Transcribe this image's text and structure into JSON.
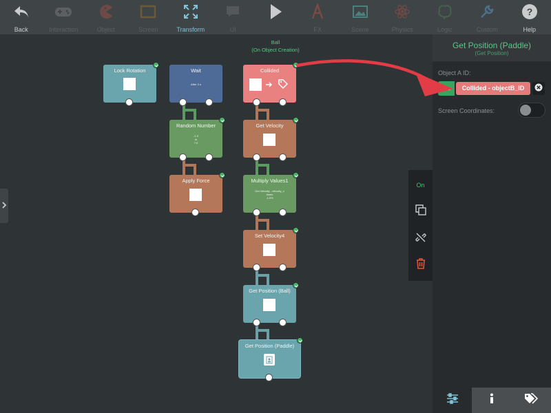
{
  "toolbar": {
    "items": [
      {
        "label": "Back",
        "icon": "back-arrow-icon",
        "state": "on"
      },
      {
        "label": "Interaction",
        "icon": "gamepad-icon",
        "state": "off"
      },
      {
        "label": "Object",
        "icon": "pacman-icon",
        "state": "off"
      },
      {
        "label": "Screen",
        "icon": "screen-frame-icon",
        "state": "off"
      },
      {
        "label": "Transform",
        "icon": "arrows-expand-icon",
        "state": "active"
      },
      {
        "label": "UI",
        "icon": "speech-bubble-icon",
        "state": "off"
      },
      {
        "label": "",
        "icon": "play-icon",
        "state": "on"
      },
      {
        "label": "FX",
        "icon": "text-fx-icon",
        "state": "off"
      },
      {
        "label": "Scene",
        "icon": "image-icon",
        "state": "off"
      },
      {
        "label": "Physics",
        "icon": "atom-icon",
        "state": "off"
      },
      {
        "label": "Logic",
        "icon": "brain-icon",
        "state": "off"
      },
      {
        "label": "Custom",
        "icon": "wrench-icon",
        "state": "off"
      },
      {
        "label": "Help",
        "icon": "help-icon",
        "state": "on"
      }
    ]
  },
  "canvas": {
    "event_caption": {
      "object": "Ball",
      "trigger": "(On Object Creation)"
    },
    "nodes": {
      "lock_rotation": {
        "title": "Lock Rotation"
      },
      "wait": {
        "title": "Wait",
        "detail": "After 3 s"
      },
      "random_number": {
        "title": "Random Number",
        "detail_lines": [
          "-1.0",
          "to",
          "7.0"
        ]
      },
      "apply_force": {
        "title": "Apply Force"
      },
      "collided": {
        "title": "Collided"
      },
      "get_velocity": {
        "title": "Get Velocity"
      },
      "multiply_values": {
        "title": "Multiply Values1",
        "detail_lines": [
          "Get Velocity - velocity_x",
          "times",
          "-1.0%"
        ]
      },
      "set_velocity": {
        "title": "Set Velocity4"
      },
      "get_position_ball": {
        "title": "Get Position (Ball)"
      },
      "get_position_paddle": {
        "title": "Get Position (Paddle)"
      }
    },
    "colors": {
      "teal": "#6aa4ad",
      "blue": "#4e6a97",
      "green": "#699a62",
      "brown": "#b4775a",
      "coral": "#e98181",
      "wire_green": "#5b9a60"
    }
  },
  "tool_strip": {
    "on_label": "On",
    "accent": "#47c07a",
    "delete_color": "#e0553a"
  },
  "panel": {
    "title": "Get Position (Paddle)",
    "subtitle": "(Get Position)",
    "object_a_label": "Object A ID:",
    "object_a_value": "Collided - objectB_ID",
    "screen_coords_label": "Screen Coordinates:",
    "screen_coords_on": false,
    "tabs": [
      {
        "icon": "sliders-icon",
        "active": true
      },
      {
        "icon": "info-icon",
        "active": false
      },
      {
        "icon": "tags-icon",
        "active": false
      }
    ]
  }
}
